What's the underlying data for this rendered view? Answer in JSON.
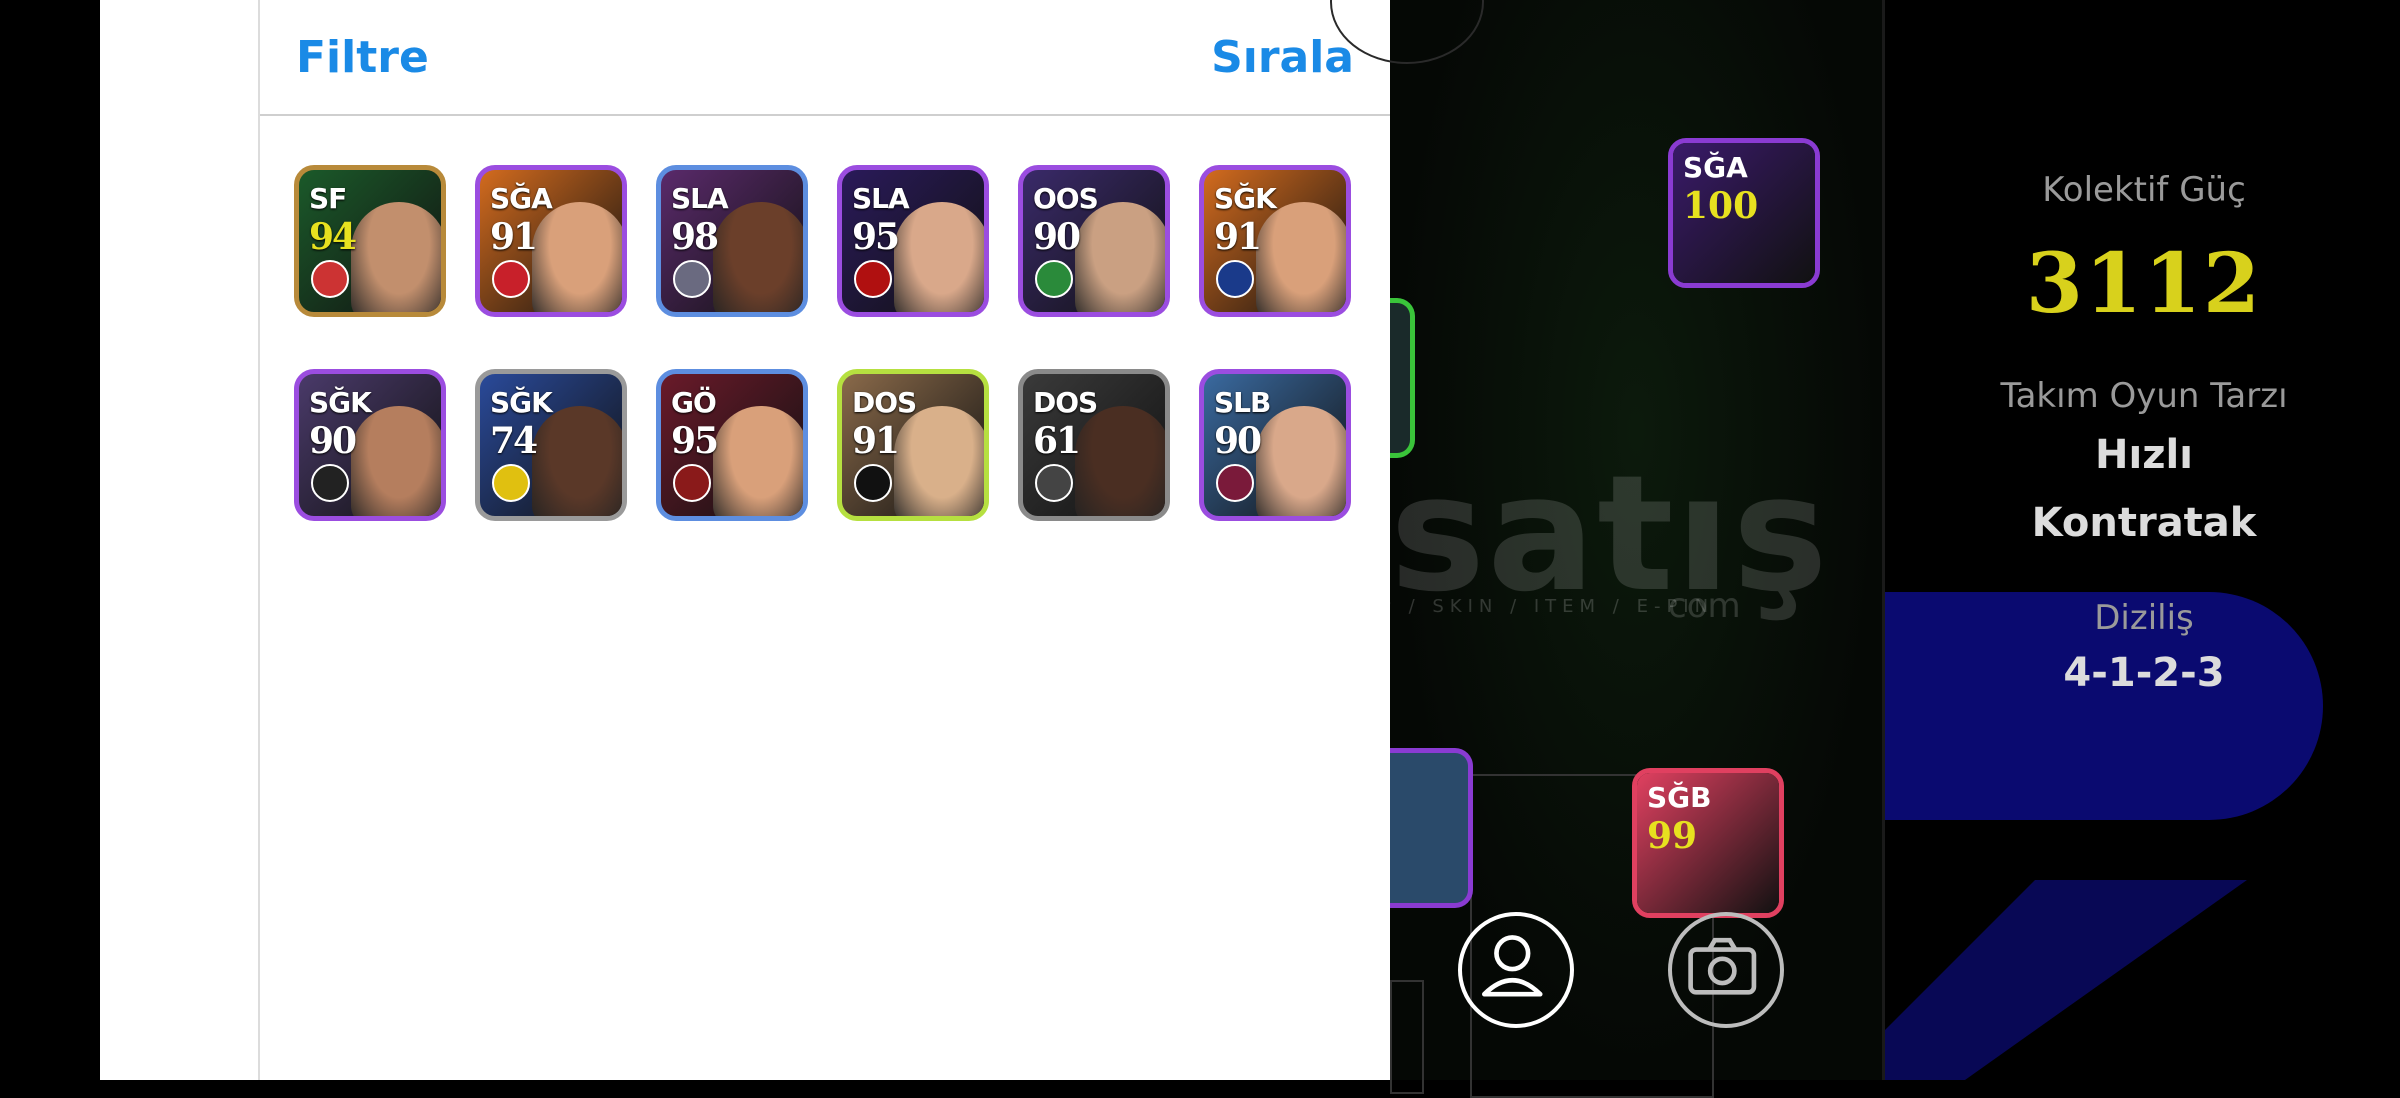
{
  "filter_panel": {
    "filter_label": "Filtre",
    "sort_label": "Sırala",
    "players": [
      {
        "position": "SF",
        "rating": "94",
        "border": "#b88a3a",
        "bg": "#1b5a2a",
        "face": "#c28f6d",
        "badge": "#c33",
        "pos_color": "#ffffff",
        "rating_color": "#e7e11f"
      },
      {
        "position": "SĞA",
        "rating": "91",
        "border": "#9b4de0",
        "bg": "#d36b1e",
        "face": "#d9a07a",
        "badge": "#c8202a",
        "pos_color": "#ffffff",
        "rating_color": "#ffffff"
      },
      {
        "position": "SLA",
        "rating": "98",
        "border": "#5d8ee0",
        "bg": "#5a2a6b",
        "face": "#6b3f2a",
        "badge": "#6a6a80",
        "pos_color": "#ffffff",
        "rating_color": "#ffffff"
      },
      {
        "position": "SLA",
        "rating": "95",
        "border": "#9b4de0",
        "bg": "#2a1a5a",
        "face": "#d9a88a",
        "badge": "#b01010",
        "pos_color": "#ffffff",
        "rating_color": "#ffffff"
      },
      {
        "position": "OOS",
        "rating": "90",
        "border": "#9b4de0",
        "bg": "#3a2a6a",
        "face": "#caa082",
        "badge": "#2a8a3a",
        "pos_color": "#ffffff",
        "rating_color": "#ffffff"
      },
      {
        "position": "SĞK",
        "rating": "91",
        "border": "#9b4de0",
        "bg": "#d36b1e",
        "face": "#d9a07a",
        "badge": "#1a3a8a",
        "pos_color": "#ffffff",
        "rating_color": "#ffffff"
      },
      {
        "position": "SĞK",
        "rating": "90",
        "border": "#9b4de0",
        "bg": "#4a3a6a",
        "face": "#b57e5e",
        "badge": "#222222",
        "pos_color": "#ffffff",
        "rating_color": "#ffffff"
      },
      {
        "position": "SĞK",
        "rating": "74",
        "border": "#9a9a9a",
        "bg": "#2a4a9a",
        "face": "#5a3828",
        "badge": "#e0c010",
        "pos_color": "#ffffff",
        "rating_color": "#ffffff"
      },
      {
        "position": "GÖ",
        "rating": "95",
        "border": "#5d8ee0",
        "bg": "#6a1a2a",
        "face": "#d9a07a",
        "badge": "#8a1a1a",
        "pos_color": "#ffffff",
        "rating_color": "#ffffff"
      },
      {
        "position": "DOS",
        "rating": "91",
        "border": "#b6e040",
        "bg": "#8a6a4a",
        "face": "#d9b08a",
        "badge": "#111111",
        "pos_color": "#ffffff",
        "rating_color": "#ffffff"
      },
      {
        "position": "DOS",
        "rating": "61",
        "border": "#8a8a8a",
        "bg": "#3a3a3a",
        "face": "#4a2e22",
        "badge": "#444444",
        "pos_color": "#ffffff",
        "rating_color": "#ffffff"
      },
      {
        "position": "SLB",
        "rating": "90",
        "border": "#9b4de0",
        "bg": "#3a6aa0",
        "face": "#d9a88a",
        "badge": "#7a1a3a",
        "pos_color": "#ffffff",
        "rating_color": "#ffffff"
      }
    ]
  },
  "pitch": {
    "watermark": "satış",
    "watermark_sub": "P / SKIN / ITEM / E-PIN",
    "watermark_com": "com",
    "cards": [
      {
        "position": "SĞA",
        "rating": "100",
        "bg": "#3a1a6a",
        "pos_color": "#ffffff",
        "rating_color": "#e7e11f"
      },
      {
        "position": "SĞB",
        "rating": "99",
        "bg": "#e04060",
        "pos_color": "#ffffff",
        "rating_color": "#e7e11f"
      }
    ]
  },
  "team_info": {
    "power_label": "Kolektif Güç",
    "power_value": "3112",
    "style_label": "Takım Oyun Tarzı",
    "style_value_line1": "Hızlı",
    "style_value_line2": "Kontratak",
    "formation_label": "Diziliş",
    "formation_value": "4-1-2-3"
  },
  "icons": {
    "back": "chevron-left-icon",
    "profile": "person-icon",
    "camera": "camera-icon"
  }
}
